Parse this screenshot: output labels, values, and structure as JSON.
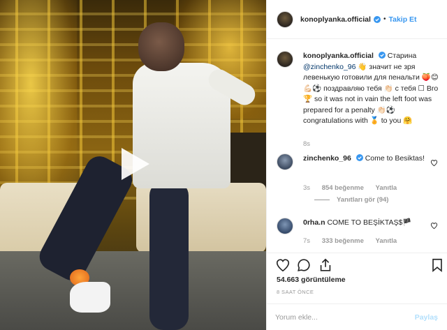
{
  "header": {
    "username": "konoplyanka.official",
    "separator": "•",
    "follow_label": "Takip Et"
  },
  "caption": {
    "username": "konoplyanka.official",
    "text_before": "Старина",
    "mention": "@zinchenko_96",
    "text_after": "👋 значит не зря левенькую готовили для пенальти 🍑😊💪🏻⚽ поздравляю тебя 👏🏻 с тебя ☐ Bro 🏆 so it was not in vain the left foot was prepared for a penalty 👏🏻⚽ congratulations with 🏅 to you 🤗",
    "age": "8s"
  },
  "comments": [
    {
      "username": "zinchenko_96",
      "text": "Come to Besiktas!",
      "age": "3s",
      "likes": "854 beğenme",
      "reply_label": "Yanıtla",
      "view_replies": "Yanıtları gör (94)",
      "verified": true
    },
    {
      "username": "0rha.n",
      "text": "COME TO BEŞİKTAŞ$🏴",
      "age": "7s",
      "likes": "333 beğenme",
      "reply_label": "Yanıtla",
      "verified": false
    }
  ],
  "stats": {
    "views": "54.663 görüntüleme",
    "time_ago": "8 SAAT ÖNCE"
  },
  "comment_form": {
    "placeholder": "Yorum ekle...",
    "post_label": "Paylaş"
  },
  "icons": [
    "play-icon",
    "verified-badge-icon",
    "heart-icon",
    "comment-icon",
    "share-icon",
    "bookmark-icon"
  ],
  "colors": {
    "accent": "#3897f0",
    "verified": "#3897f0",
    "muted": "#999999",
    "text": "#262626",
    "post_disabled": "#b2dffc"
  }
}
